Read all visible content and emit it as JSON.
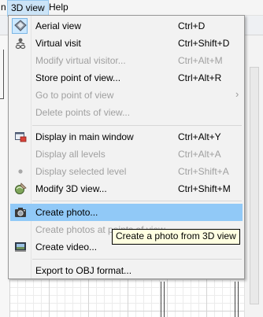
{
  "menubar": {
    "cut_label": "n",
    "view_3d_label": "3D view",
    "help_label": "Help"
  },
  "menu": {
    "items": [
      {
        "label": "Aerial view",
        "shortcut": "Ctrl+D",
        "icon": "aerial-view-icon"
      },
      {
        "label": "Virtual visit",
        "shortcut": "Ctrl+Shift+D",
        "icon": "visitor-icon"
      },
      {
        "label": "Modify virtual visitor...",
        "shortcut": "Ctrl+Alt+M"
      },
      {
        "label": "Store point of view...",
        "shortcut": "Ctrl+Alt+R"
      },
      {
        "label": "Go to point of view",
        "arrow": "›"
      },
      {
        "label": "Delete points of view..."
      },
      {
        "label": "Display in main window",
        "shortcut": "Ctrl+Alt+Y",
        "icon": "display-window-icon"
      },
      {
        "label": "Display all levels",
        "shortcut": "Ctrl+Alt+A"
      },
      {
        "label": "Display selected level",
        "shortcut": "Ctrl+Shift+A",
        "icon": "bullet-icon"
      },
      {
        "label": "Modify 3D view...",
        "shortcut": "Ctrl+Shift+M",
        "icon": "modify-3d-icon"
      },
      {
        "label": "Create photo...",
        "icon": "camera-icon"
      },
      {
        "label": "Create photos at points of view..."
      },
      {
        "label": "Create video...",
        "icon": "video-icon"
      },
      {
        "label": "Export to OBJ format..."
      }
    ]
  },
  "tooltip": {
    "text": "Create a photo from 3D view"
  },
  "colors": {
    "highlight": "#91c9f7",
    "checked_bg": "#cce8ff",
    "tooltip_bg": "#ffffe1",
    "disabled_text": "#a0a0a0"
  }
}
